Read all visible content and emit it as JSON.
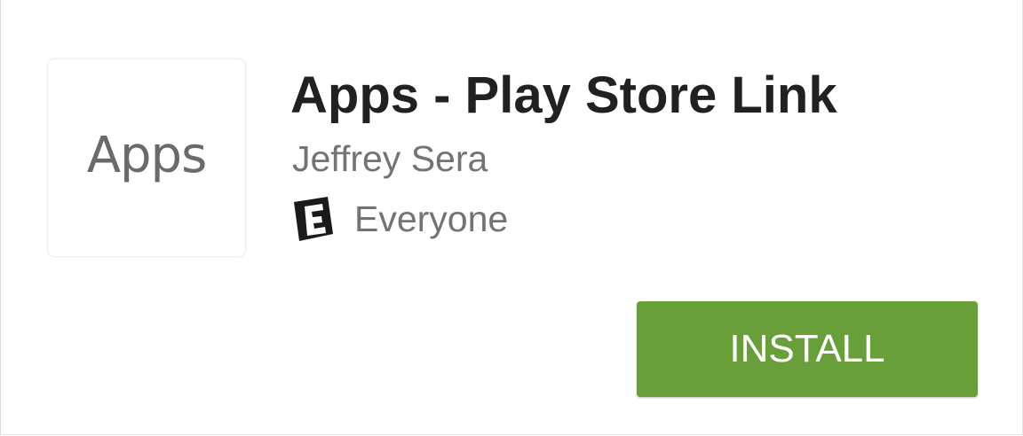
{
  "app": {
    "icon_text": "Apps",
    "title": "Apps - Play Store Link",
    "developer": "Jeffrey Sera",
    "content_rating": {
      "icon": "esrb-everyone-icon",
      "label": "Everyone"
    }
  },
  "actions": {
    "install_label": "INSTALL"
  },
  "colors": {
    "install_button": "#689f38",
    "title_text": "#212121",
    "secondary_text": "#737373"
  }
}
